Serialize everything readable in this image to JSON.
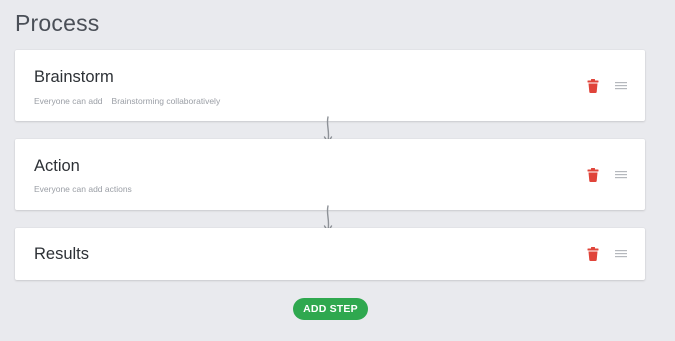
{
  "page": {
    "title": "Process"
  },
  "steps": [
    {
      "title": "Brainstorm",
      "meta": [
        "Everyone can add",
        "Brainstorming collaboratively"
      ]
    },
    {
      "title": "Action",
      "meta": [
        "Everyone can add actions"
      ]
    },
    {
      "title": "Results",
      "meta": []
    }
  ],
  "actions": {
    "add_step_label": "ADD STEP"
  },
  "icons": {
    "delete": "trash-icon",
    "drag": "drag-handle-icon",
    "connector": "arrow-down-icon"
  },
  "colors": {
    "background": "#e9eaee",
    "card": "#ffffff",
    "delete_icon": "#e0443a",
    "drag_icon": "#b5b8bd",
    "add_button": "#2fa84f",
    "connector": "#8d9197"
  }
}
